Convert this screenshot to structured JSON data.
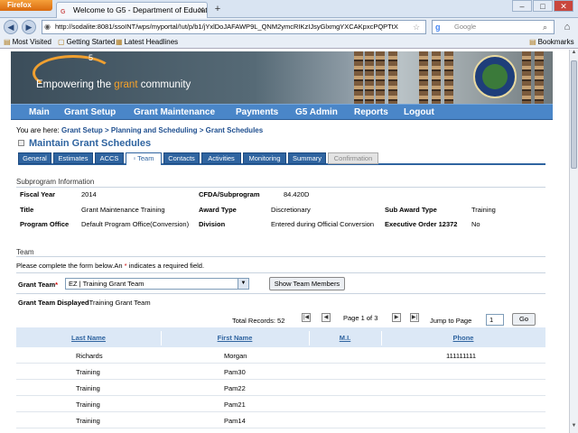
{
  "browser": {
    "app_button": "Firefox",
    "tab_title": "Welcome to G5 - Department of Educati...",
    "new_tab": "+",
    "url": "http://sodalite:8081/ssoINT/wps/myportal/!ut/p/b1/jYxlDoJAFAWP9L_QNM2ymcRIKzIJsyGlxmgYXCAKpxcPQPTtX",
    "search_placeholder": "Google",
    "bookmarks": [
      "Most Visited",
      "Getting Started",
      "Latest Headlines"
    ],
    "bookmarks_menu": "Bookmarks"
  },
  "banner": {
    "logo_letter": "G",
    "logo_sup": "5",
    "tagline_pre": "Empowering the ",
    "tagline_highlight": "grant",
    "tagline_post": " community"
  },
  "main_nav": [
    "Main",
    "Grant Setup",
    "Grant Maintenance",
    "Payments",
    "G5 Admin",
    "Reports",
    "Logout"
  ],
  "breadcrumb": {
    "prefix": "You are here:",
    "items": [
      "Grant Setup",
      "Planning and Scheduling",
      "Grant Schedules"
    ],
    "separator": ">"
  },
  "page_title": "Maintain Grant Schedules",
  "tabs": [
    "General",
    "Estimates",
    "ACCS",
    "Team",
    "Contacts",
    "Activities",
    "Monitoring",
    "Summary",
    "Confirmation"
  ],
  "active_tab": "Team",
  "subprogram": {
    "heading": "Subprogram Information",
    "rows": [
      [
        {
          "label": "Fiscal Year",
          "value": "2014"
        },
        {
          "label": "CFDA/Subprogram",
          "value": "84.420D"
        },
        {
          "label": "",
          "value": ""
        }
      ],
      [
        {
          "label": "Title",
          "value": "Grant Maintenance Training"
        },
        {
          "label": "Award Type",
          "value": "Discretionary"
        },
        {
          "label": "Sub Award Type",
          "value": "Training"
        }
      ],
      [
        {
          "label": "Program Office",
          "value": "Default Program Office(Conversion)"
        },
        {
          "label": "Division",
          "value": "Entered during Official Conversion"
        },
        {
          "label": "Executive Order 12372",
          "value": "No"
        }
      ]
    ]
  },
  "team": {
    "heading": "Team",
    "instructions_pre": "Please complete the form below.An ",
    "required_mark": "*",
    "instructions_post": " indicates a required field.",
    "grant_team_label": "Grant Team",
    "grant_team_value": "EZ | Training Grant Team",
    "show_button": "Show Team Members",
    "displayed_label": "Grant Team Displayed",
    "displayed_value": "Training Grant Team"
  },
  "pager": {
    "total_records": "Total Records: 52",
    "page_info": "Page 1 of 3",
    "jump_label": "Jump to Page",
    "jump_value": "1",
    "go_button": "Go"
  },
  "grid": {
    "columns": [
      "Last Name",
      "First Name",
      "M.I.",
      "Phone"
    ],
    "rows": [
      [
        "Richards",
        "Morgan",
        "",
        "111111111"
      ],
      [
        "Training",
        "Pam30",
        "",
        ""
      ],
      [
        "Training",
        "Pam22",
        "",
        ""
      ],
      [
        "Training",
        "Pam21",
        "",
        ""
      ],
      [
        "Training",
        "Pam14",
        "",
        ""
      ]
    ]
  }
}
